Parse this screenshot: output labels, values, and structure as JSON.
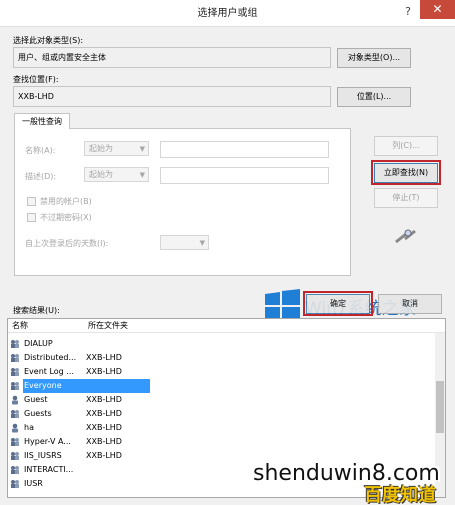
{
  "window": {
    "title": "选择用户或组",
    "help_glyph": "?",
    "close_glyph": "✕"
  },
  "object_type": {
    "label": "选择此对象类型(S):",
    "value": "用户、组或内置安全主体",
    "button": "对象类型(O)..."
  },
  "location": {
    "label": "查找位置(F):",
    "value": "XXB-LHD",
    "button": "位置(L)..."
  },
  "query": {
    "tab": "一般性查询",
    "name_label": "名称(A):",
    "name_op": "起始为",
    "desc_label": "描述(D):",
    "desc_op": "起始为",
    "disabled_accounts": "禁用的帐户(B)",
    "no_expire_pwd": "不过期密码(X)",
    "days_label": "自上次登录后的天数(I):"
  },
  "side_buttons": {
    "columns": "列(C)...",
    "find_now": "立即查找(N)",
    "stop": "停止(T)"
  },
  "footer_buttons": {
    "ok": "确定",
    "cancel": "取消"
  },
  "results": {
    "label": "搜索结果(U):",
    "col_name": "名称",
    "col_folder": "所在文件夹",
    "rows": [
      {
        "name": "DIALUP",
        "folder": "",
        "icon": "group-icon"
      },
      {
        "name": "Distributed...",
        "folder": "XXB-LHD",
        "icon": "group-icon"
      },
      {
        "name": "Event Log ...",
        "folder": "XXB-LHD",
        "icon": "group-icon"
      },
      {
        "name": "Everyone",
        "folder": "",
        "icon": "group-icon"
      },
      {
        "name": "Guest",
        "folder": "XXB-LHD",
        "icon": "user-icon"
      },
      {
        "name": "Guests",
        "folder": "XXB-LHD",
        "icon": "group-icon"
      },
      {
        "name": "ha",
        "folder": "XXB-LHD",
        "icon": "user-icon"
      },
      {
        "name": "Hyper-V A...",
        "folder": "XXB-LHD",
        "icon": "group-icon"
      },
      {
        "name": "IIS_IUSRS",
        "folder": "XXB-LHD",
        "icon": "group-icon"
      },
      {
        "name": "INTERACTI...",
        "folder": "",
        "icon": "group-icon"
      },
      {
        "name": "IUSR",
        "folder": "",
        "icon": "group-icon"
      }
    ],
    "selected_index": 3
  },
  "watermarks": {
    "win7": "Win7系统之家",
    "site": "shenduwin8.com",
    "logo": "百度知道"
  },
  "colors": {
    "highlight_red": "#c0262c",
    "selection_blue": "#3399ff",
    "close_red": "#c7493a"
  }
}
